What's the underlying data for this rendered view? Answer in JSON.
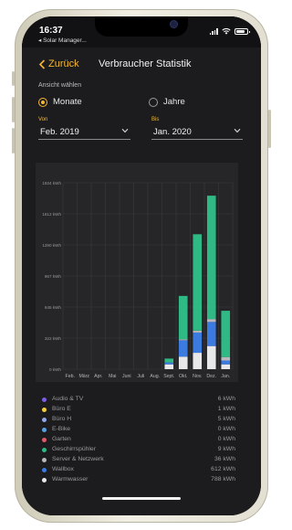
{
  "status_bar": {
    "time": "16:37",
    "back_app": "◂ Solar Manager..."
  },
  "nav": {
    "back_label": "Zurück",
    "title": "Verbraucher Statistik"
  },
  "view": {
    "heading": "Ansicht wählen",
    "options": [
      {
        "label": "Monate",
        "selected": true
      },
      {
        "label": "Jahre",
        "selected": false
      }
    ]
  },
  "range": {
    "from_label": "Von",
    "from_value": "Feb. 2019",
    "to_label": "Bis",
    "to_value": "Jan. 2020"
  },
  "colors": {
    "accent": "#f5b731"
  },
  "chart_data": {
    "type": "bar",
    "stacked": true,
    "categories": [
      "Feb.",
      "März",
      "Apr.",
      "Mai",
      "Juni",
      "Juli",
      "Aug.",
      "Sept.",
      "Okt.",
      "Nov.",
      "Dez.",
      "Jan."
    ],
    "y_ticks": [
      "1934 kWh",
      "1612 kWh",
      "1290 kWh",
      "967 kWh",
      "645 kWh",
      "322 kWh",
      "0 kWh"
    ],
    "ylim": [
      0,
      1934
    ],
    "grid": true,
    "series": [
      {
        "name": "Warmwasser",
        "color": "#e8e8ea",
        "values": [
          0,
          0,
          0,
          0,
          0,
          0,
          0,
          50,
          130,
          170,
          240,
          50
        ]
      },
      {
        "name": "Wallbox",
        "color": "#3b7be0",
        "values": [
          0,
          0,
          0,
          0,
          0,
          0,
          0,
          20,
          170,
          210,
          250,
          40
        ]
      },
      {
        "name": "Server & Netzwerk",
        "color": "#b9b9bd",
        "values": [
          0,
          0,
          0,
          0,
          0,
          0,
          0,
          0,
          10,
          20,
          30,
          36
        ]
      },
      {
        "name": "Geschirrspühler",
        "color": "#2fb984",
        "values": [
          0,
          0,
          0,
          0,
          0,
          0,
          0,
          40,
          450,
          1000,
          1280,
          480
        ]
      }
    ]
  },
  "legend": [
    {
      "name": "Audio & TV",
      "value": "6 kWh",
      "color": "#7b5fe0"
    },
    {
      "name": "Büro E",
      "value": "1 kWh",
      "color": "#f2cf3c"
    },
    {
      "name": "Büro H",
      "value": "5 kWh",
      "color": "#8fa8e8"
    },
    {
      "name": "E-Bike",
      "value": "0 kWh",
      "color": "#5aa0e6"
    },
    {
      "name": "Garten",
      "value": "0 kWh",
      "color": "#e05a6a"
    },
    {
      "name": "Geschirrspühler",
      "value": "9 kWh",
      "color": "#2fb984"
    },
    {
      "name": "Server & Netzwerk",
      "value": "36 kWh",
      "color": "#b9b9bd"
    },
    {
      "name": "Wallbox",
      "value": "612 kWh",
      "color": "#3b7be0"
    },
    {
      "name": "Warmwasser",
      "value": "788 kWh",
      "color": "#e8e8ea"
    }
  ]
}
